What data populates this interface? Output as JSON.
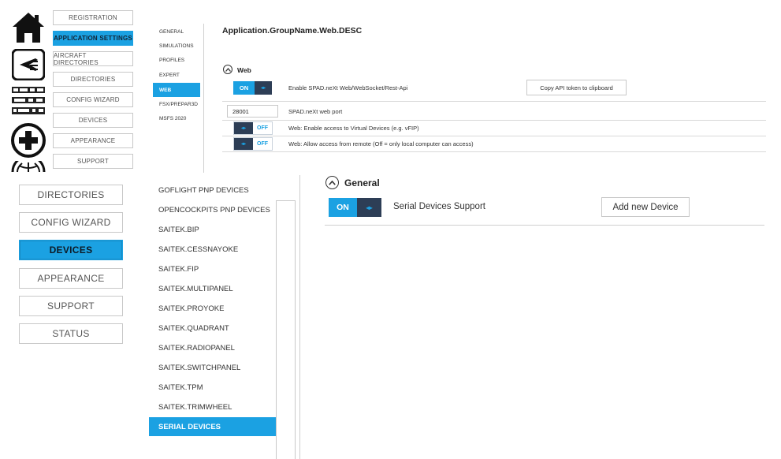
{
  "top": {
    "nav": [
      {
        "label": "REGISTRATION",
        "active": false
      },
      {
        "label": "APPLICATION SETTINGS",
        "active": true
      },
      {
        "label": "AIRCRAFT DIRECTORIES",
        "active": false
      },
      {
        "label": "DIRECTORIES",
        "active": false
      },
      {
        "label": "CONFIG WIZARD",
        "active": false
      },
      {
        "label": "DEVICES",
        "active": false
      },
      {
        "label": "APPEARANCE",
        "active": false
      },
      {
        "label": "SUPPORT",
        "active": false
      }
    ],
    "subnav": [
      {
        "label": "GENERAL",
        "active": false
      },
      {
        "label": "SIMULATIONS",
        "active": false
      },
      {
        "label": "PROFILES",
        "active": false
      },
      {
        "label": "EXPERT",
        "active": false
      },
      {
        "label": "WEB",
        "active": true
      },
      {
        "label": "FSX/PREPAR3D",
        "active": false
      },
      {
        "label": "MSFS 2020",
        "active": false
      }
    ],
    "title": "Application.GroupName.Web.DESC",
    "section_title": "Web",
    "rows": {
      "enable_web": {
        "toggle": "ON",
        "text": "Enable SPAD.neXt Web/WebSocket/Rest-Api",
        "button": "Copy API token to clipboard"
      },
      "port": {
        "value": "28001",
        "text": "SPAD.neXt web port"
      },
      "virtual_devices": {
        "toggle": "OFF",
        "text": "Web: Enable access to Virtual Devices (e.g. vFIP)"
      },
      "remote_access": {
        "toggle": "OFF",
        "text": "Web: Allow access from remote (Off = only local computer can access)"
      }
    }
  },
  "bottom": {
    "nav": [
      {
        "label": "DIRECTORIES",
        "active": false
      },
      {
        "label": "CONFIG WIZARD",
        "active": false
      },
      {
        "label": "DEVICES",
        "active": true
      },
      {
        "label": "APPEARANCE",
        "active": false
      },
      {
        "label": "SUPPORT",
        "active": false
      },
      {
        "label": "STATUS",
        "active": false
      }
    ],
    "devices": [
      {
        "label": "GOFLIGHT PNP DEVICES",
        "active": false
      },
      {
        "label": "OPENCOCKPITS PNP DEVICES",
        "active": false
      },
      {
        "label": "SAITEK.BIP",
        "active": false
      },
      {
        "label": "SAITEK.CESSNAYOKE",
        "active": false
      },
      {
        "label": "SAITEK.FIP",
        "active": false
      },
      {
        "label": "SAITEK.MULTIPANEL",
        "active": false
      },
      {
        "label": "SAITEK.PROYOKE",
        "active": false
      },
      {
        "label": "SAITEK.QUADRANT",
        "active": false
      },
      {
        "label": "SAITEK.RADIOPANEL",
        "active": false
      },
      {
        "label": "SAITEK.SWITCHPANEL",
        "active": false
      },
      {
        "label": "SAITEK.TPM",
        "active": false
      },
      {
        "label": "SAITEK.TRIMWHEEL",
        "active": false
      },
      {
        "label": "SERIAL DEVICES",
        "active": true
      }
    ],
    "section_title": "General",
    "serial": {
      "toggle": "ON",
      "text": "Serial Devices Support",
      "button": "Add new Device"
    }
  },
  "icons": [
    "home-icon",
    "aircraft-icon",
    "panel-device-icon",
    "plus-circle-icon",
    "globe-icon",
    "chevron-up-icon",
    "arrows-icon"
  ],
  "colors": {
    "accent": "#1ba1e2",
    "knob": "#2d3e56"
  }
}
